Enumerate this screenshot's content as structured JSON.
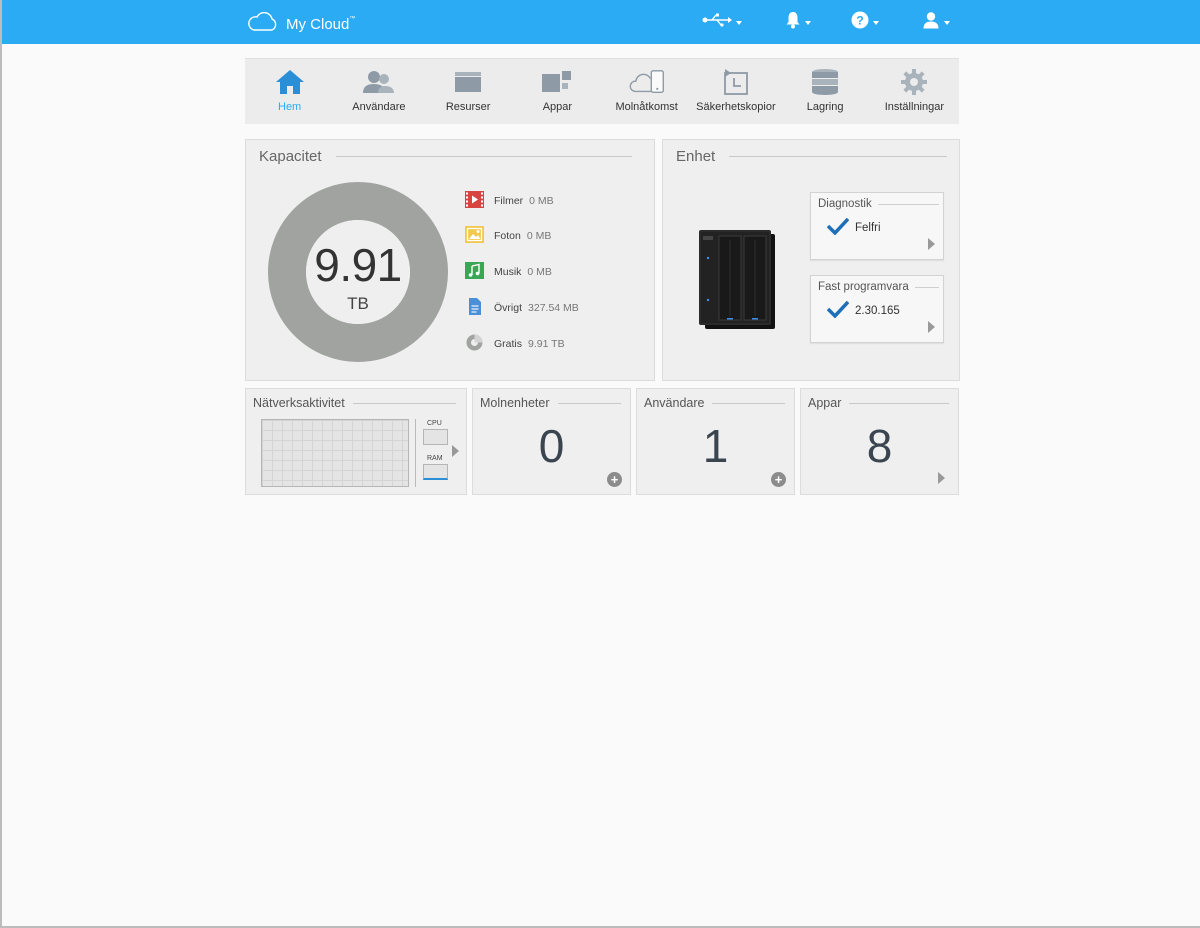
{
  "header": {
    "app_name": "My Cloud",
    "trademark": "™",
    "icons": [
      "cloud-logo",
      "usb-icon",
      "bell-icon",
      "help-icon",
      "user-icon"
    ]
  },
  "nav": {
    "items": [
      {
        "label": "Hem",
        "icon": "home-icon",
        "active": true
      },
      {
        "label": "Användare",
        "icon": "users-icon",
        "active": false
      },
      {
        "label": "Resurser",
        "icon": "folder-icon",
        "active": false
      },
      {
        "label": "Appar",
        "icon": "apps-icon",
        "active": false
      },
      {
        "label": "Molnåtkomst",
        "icon": "cloud-device-icon",
        "active": false
      },
      {
        "label": "Säkerhetskopior",
        "icon": "backup-icon",
        "active": false
      },
      {
        "label": "Lagring",
        "icon": "storage-icon",
        "active": false
      },
      {
        "label": "Inställningar",
        "icon": "gear-icon",
        "active": false
      }
    ]
  },
  "capacity": {
    "title": "Kapacitet",
    "free_value": "9.91",
    "free_unit": "TB",
    "legend": [
      {
        "label": "Filmer",
        "value": "0 MB",
        "icon": "film-icon",
        "color": "#d64541"
      },
      {
        "label": "Foton",
        "value": "0 MB",
        "icon": "photo-icon",
        "color": "#f2c94c"
      },
      {
        "label": "Musik",
        "value": "0 MB",
        "icon": "music-icon",
        "color": "#3aa757"
      },
      {
        "label": "Övrigt",
        "value": "327.54 MB",
        "icon": "document-icon",
        "color": "#4a90d9"
      },
      {
        "label": "Gratis",
        "value": "9.91 TB",
        "icon": "pie-icon",
        "color": "#a0a3a0"
      }
    ]
  },
  "device": {
    "title": "Enhet",
    "diagnostics": {
      "title": "Diagnostik",
      "value": "Felfri"
    },
    "firmware": {
      "title": "Fast programvara",
      "value": "2.30.165"
    }
  },
  "network": {
    "title": "Nätverksaktivitet",
    "cpu_label": "CPU",
    "ram_label": "RAM"
  },
  "cloud_devices": {
    "title": "Molnenheter",
    "count": "0"
  },
  "users": {
    "title": "Användare",
    "count": "1"
  },
  "apps": {
    "title": "Appar",
    "count": "8"
  },
  "colors": {
    "accent": "#2aabf3",
    "panel": "#efefef",
    "donut": "#a0a3a0",
    "check": "#1f6fb8"
  }
}
